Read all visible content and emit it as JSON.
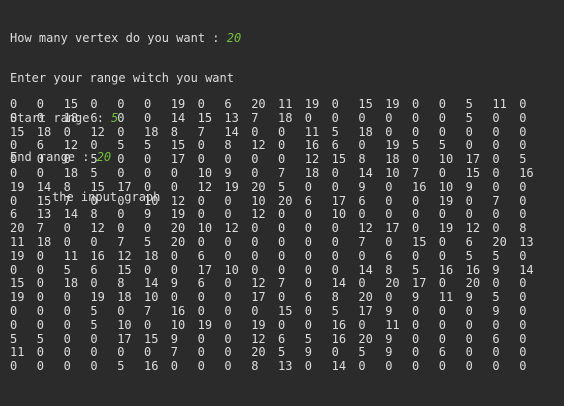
{
  "prompts": {
    "vertex_label": "How many vertex do you want : ",
    "vertex_value": "20",
    "range_label": "Enter your range witch you want",
    "start_label": "Start range : ",
    "start_value": "5",
    "end_label": "End range : ",
    "end_value": "20",
    "graph_title": "the input graph"
  },
  "colors": {
    "background": "#2b2b2b",
    "text": "#dcdcdc",
    "input": "#6fc13b"
  },
  "matrix": [
    [
      0,
      0,
      15,
      0,
      0,
      0,
      19,
      0,
      6,
      20,
      11,
      19,
      0,
      15,
      19,
      0,
      0,
      5,
      11,
      0
    ],
    [
      0,
      0,
      18,
      6,
      0,
      0,
      14,
      15,
      13,
      7,
      18,
      0,
      0,
      0,
      0,
      0,
      0,
      5,
      0,
      0
    ],
    [
      15,
      18,
      0,
      12,
      0,
      18,
      8,
      7,
      14,
      0,
      0,
      11,
      5,
      18,
      0,
      0,
      0,
      0,
      0,
      0
    ],
    [
      0,
      6,
      12,
      0,
      5,
      5,
      15,
      0,
      8,
      12,
      0,
      16,
      6,
      0,
      19,
      5,
      5,
      0,
      0,
      0
    ],
    [
      0,
      0,
      0,
      5,
      0,
      0,
      17,
      0,
      0,
      0,
      0,
      12,
      15,
      8,
      18,
      0,
      10,
      17,
      0,
      5
    ],
    [
      0,
      0,
      18,
      5,
      0,
      0,
      0,
      10,
      9,
      0,
      7,
      18,
      0,
      14,
      10,
      7,
      0,
      15,
      0,
      16
    ],
    [
      19,
      14,
      8,
      15,
      17,
      0,
      0,
      12,
      19,
      20,
      5,
      0,
      0,
      9,
      0,
      16,
      10,
      9,
      0,
      0
    ],
    [
      0,
      15,
      7,
      0,
      0,
      10,
      12,
      0,
      0,
      10,
      20,
      6,
      17,
      6,
      0,
      0,
      19,
      0,
      7,
      0
    ],
    [
      6,
      13,
      14,
      8,
      0,
      9,
      19,
      0,
      0,
      12,
      0,
      0,
      10,
      0,
      0,
      0,
      0,
      0,
      0,
      0
    ],
    [
      20,
      7,
      0,
      12,
      0,
      0,
      20,
      10,
      12,
      0,
      0,
      0,
      0,
      12,
      17,
      0,
      19,
      12,
      0,
      8
    ],
    [
      11,
      18,
      0,
      0,
      7,
      5,
      20,
      0,
      0,
      0,
      0,
      0,
      0,
      7,
      0,
      15,
      0,
      6,
      20,
      13
    ],
    [
      19,
      0,
      11,
      16,
      12,
      18,
      0,
      6,
      0,
      0,
      0,
      0,
      0,
      0,
      6,
      0,
      0,
      5,
      5,
      0
    ],
    [
      0,
      0,
      5,
      6,
      15,
      0,
      0,
      17,
      10,
      0,
      0,
      0,
      0,
      14,
      8,
      5,
      16,
      16,
      9,
      14
    ],
    [
      15,
      0,
      18,
      0,
      8,
      14,
      9,
      6,
      0,
      12,
      7,
      0,
      14,
      0,
      20,
      17,
      0,
      20,
      0,
      0
    ],
    [
      19,
      0,
      0,
      19,
      18,
      10,
      0,
      0,
      0,
      17,
      0,
      6,
      8,
      20,
      0,
      9,
      11,
      9,
      5,
      0
    ],
    [
      0,
      0,
      0,
      5,
      0,
      7,
      16,
      0,
      0,
      0,
      15,
      0,
      5,
      17,
      9,
      0,
      0,
      0,
      9,
      0
    ],
    [
      0,
      0,
      0,
      5,
      10,
      0,
      10,
      19,
      0,
      19,
      0,
      0,
      16,
      0,
      11,
      0,
      0,
      0,
      0,
      0
    ],
    [
      5,
      5,
      0,
      0,
      17,
      15,
      9,
      0,
      0,
      12,
      6,
      5,
      16,
      20,
      9,
      0,
      0,
      0,
      6,
      0
    ],
    [
      11,
      0,
      0,
      0,
      0,
      0,
      7,
      0,
      0,
      20,
      5,
      9,
      0,
      5,
      9,
      0,
      6,
      0,
      0,
      0
    ],
    [
      0,
      0,
      0,
      0,
      5,
      16,
      0,
      0,
      0,
      8,
      13,
      0,
      14,
      0,
      0,
      0,
      0,
      0,
      0,
      0
    ]
  ]
}
